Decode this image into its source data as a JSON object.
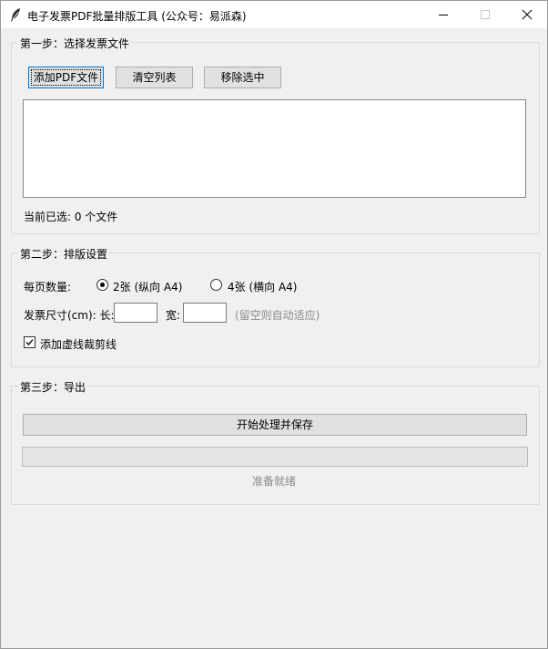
{
  "window": {
    "title": "电子发票PDF批量排版工具 (公众号：易派森)",
    "icon": "feather-icon",
    "controls": [
      "minimize-icon",
      "maximize-icon",
      "close-icon"
    ]
  },
  "step1": {
    "title": "第一步：选择发票文件",
    "add_label": "添加PDF文件",
    "clear_label": "清空列表",
    "remove_label": "移除选中",
    "files": [],
    "status": "当前已选: 0 个文件"
  },
  "step2": {
    "title": "第二步：排版设置",
    "per_page_label": "每页数量:",
    "options": [
      {
        "label": "2张 (纵向 A4)",
        "selected": true
      },
      {
        "label": "4张 (横向 A4)",
        "selected": false
      }
    ],
    "size_label": "发票尺寸(cm): 长:",
    "width_label": "宽:",
    "length_value": "",
    "width_value": "",
    "hint": "(留空则自动适应)",
    "cut_line_label": "添加虚线裁剪线",
    "cut_line_checked": true
  },
  "step3": {
    "title": "第三步：导出",
    "start_label": "开始处理并保存",
    "progress": 0,
    "status": "准备就绪"
  }
}
